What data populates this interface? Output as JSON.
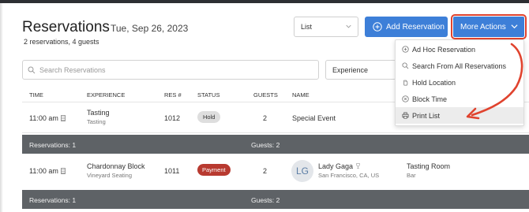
{
  "header": {
    "title": "Reservations",
    "date": "Tue, Sep 26, 2023",
    "subtitle": "2 reservations, 4 guests"
  },
  "toolbar": {
    "view_value": "List",
    "add_label": "Add Reservation",
    "more_label": "More Actions"
  },
  "filters": {
    "search_placeholder": "Search Reservations",
    "experience_label": "Experience"
  },
  "table": {
    "columns": [
      "TIME",
      "EXPERIENCE",
      "RES #",
      "STATUS",
      "GUESTS",
      "NAME"
    ],
    "rows": [
      {
        "time": "11:00 am",
        "experience": "Tasting",
        "experience_sub": "Tasting",
        "res": "1012",
        "status": "Hold",
        "guests": "2",
        "name": "Special Event"
      },
      {
        "time": "11:00 am",
        "experience": "Chardonnay Block",
        "experience_sub": "Vineyard Seating",
        "res": "1011",
        "status": "Payment",
        "guests": "2",
        "avatar": "LG",
        "name": "Lady Gaga",
        "location": "San Francisco, CA, US",
        "room": "Tasting Room",
        "room_sub": "Bar"
      }
    ],
    "summaries": [
      {
        "reservations": "Reservations: 1",
        "guests": "Guests: 2"
      },
      {
        "reservations": "Reservations: 1",
        "guests": "Guests: 2"
      }
    ]
  },
  "more_menu": {
    "items": [
      {
        "label": "Ad Hoc Reservation",
        "icon": "plus-circle-icon"
      },
      {
        "label": "Search From All Reservations",
        "icon": "search-icon"
      },
      {
        "label": "Hold Location",
        "icon": "hand-icon"
      },
      {
        "label": "Block Time",
        "icon": "block-icon"
      },
      {
        "label": "Print List",
        "icon": "printer-icon"
      }
    ]
  },
  "colors": {
    "primary": "#3d7fd8",
    "annotation": "#e0432e",
    "summary_bg": "#5e6266",
    "payment_badge": "#b83a30"
  }
}
